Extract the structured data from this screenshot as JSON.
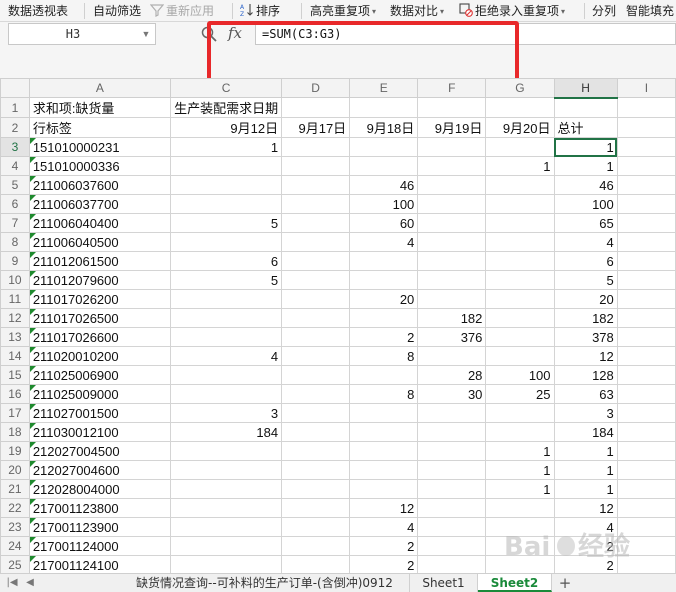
{
  "toolbar": {
    "pivot_table": "数据透视表",
    "auto_filter": "自动筛选",
    "reapply": "重新应用",
    "sort": "排序",
    "highlight_duplicates": "高亮重复项",
    "data_compare": "数据对比",
    "reject_duplicates": "拒绝录入重复项",
    "split_column": "分列",
    "smart_fill": "智能填充"
  },
  "formula_bar": {
    "cell_ref": "H3",
    "fx_label": "fx",
    "formula": "=SUM(C3:G3)"
  },
  "columns": [
    "A",
    "C",
    "D",
    "E",
    "F",
    "G",
    "H",
    "I"
  ],
  "selected_column": "H",
  "selected_row": "3",
  "pivot": {
    "row1": {
      "a": "求和项:缺货量",
      "c": "生产装配需求日期"
    },
    "row2": {
      "a": "行标签",
      "c": "9月12日",
      "d": "9月17日",
      "e": "9月18日",
      "f": "9月19日",
      "g": "9月20日",
      "h": "总计"
    }
  },
  "rows": [
    {
      "n": "3",
      "a": "151010000231",
      "c": "1",
      "d": "",
      "e": "",
      "f": "",
      "g": "",
      "h": "1"
    },
    {
      "n": "4",
      "a": "151010000336",
      "c": "",
      "d": "",
      "e": "",
      "f": "",
      "g": "1",
      "h": "1"
    },
    {
      "n": "5",
      "a": "211006037600",
      "c": "",
      "d": "",
      "e": "46",
      "f": "",
      "g": "",
      "h": "46"
    },
    {
      "n": "6",
      "a": "211006037700",
      "c": "",
      "d": "",
      "e": "100",
      "f": "",
      "g": "",
      "h": "100"
    },
    {
      "n": "7",
      "a": "211006040400",
      "c": "5",
      "d": "",
      "e": "60",
      "f": "",
      "g": "",
      "h": "65"
    },
    {
      "n": "8",
      "a": "211006040500",
      "c": "",
      "d": "",
      "e": "4",
      "f": "",
      "g": "",
      "h": "4"
    },
    {
      "n": "9",
      "a": "211012061500",
      "c": "6",
      "d": "",
      "e": "",
      "f": "",
      "g": "",
      "h": "6"
    },
    {
      "n": "10",
      "a": "211012079600",
      "c": "5",
      "d": "",
      "e": "",
      "f": "",
      "g": "",
      "h": "5"
    },
    {
      "n": "11",
      "a": "211017026200",
      "c": "",
      "d": "",
      "e": "20",
      "f": "",
      "g": "",
      "h": "20"
    },
    {
      "n": "12",
      "a": "211017026500",
      "c": "",
      "d": "",
      "e": "",
      "f": "182",
      "g": "",
      "h": "182"
    },
    {
      "n": "13",
      "a": "211017026600",
      "c": "",
      "d": "",
      "e": "2",
      "f": "376",
      "g": "",
      "h": "378"
    },
    {
      "n": "14",
      "a": "211020010200",
      "c": "4",
      "d": "",
      "e": "8",
      "f": "",
      "g": "",
      "h": "12"
    },
    {
      "n": "15",
      "a": "211025006900",
      "c": "",
      "d": "",
      "e": "",
      "f": "28",
      "g": "100",
      "h": "128"
    },
    {
      "n": "16",
      "a": "211025009000",
      "c": "",
      "d": "",
      "e": "8",
      "f": "30",
      "g": "25",
      "h": "63"
    },
    {
      "n": "17",
      "a": "211027001500",
      "c": "3",
      "d": "",
      "e": "",
      "f": "",
      "g": "",
      "h": "3"
    },
    {
      "n": "18",
      "a": "211030012100",
      "c": "184",
      "d": "",
      "e": "",
      "f": "",
      "g": "",
      "h": "184"
    },
    {
      "n": "19",
      "a": "212027004500",
      "c": "",
      "d": "",
      "e": "",
      "f": "",
      "g": "1",
      "h": "1"
    },
    {
      "n": "20",
      "a": "212027004600",
      "c": "",
      "d": "",
      "e": "",
      "f": "",
      "g": "1",
      "h": "1"
    },
    {
      "n": "21",
      "a": "212028004000",
      "c": "",
      "d": "",
      "e": "",
      "f": "",
      "g": "1",
      "h": "1"
    },
    {
      "n": "22",
      "a": "217001123800",
      "c": "",
      "d": "",
      "e": "12",
      "f": "",
      "g": "",
      "h": "12"
    },
    {
      "n": "23",
      "a": "217001123900",
      "c": "",
      "d": "",
      "e": "4",
      "f": "",
      "g": "",
      "h": "4"
    },
    {
      "n": "24",
      "a": "217001124000",
      "c": "",
      "d": "",
      "e": "2",
      "f": "",
      "g": "",
      "h": "2"
    },
    {
      "n": "25",
      "a": "217001124100",
      "c": "",
      "d": "",
      "e": "2",
      "f": "",
      "g": "",
      "h": "2"
    }
  ],
  "sheet_tabs": [
    {
      "label": "缺货情况查询--可补料的生产订单-(含倒冲)0912",
      "active": false
    },
    {
      "label": "Sheet1",
      "active": false
    },
    {
      "label": "Sheet2",
      "active": true
    }
  ],
  "add_sheet": "+",
  "colors": {
    "accent": "#217346",
    "highlight": "#e8282a",
    "active_tab": "#1a8a3a"
  }
}
